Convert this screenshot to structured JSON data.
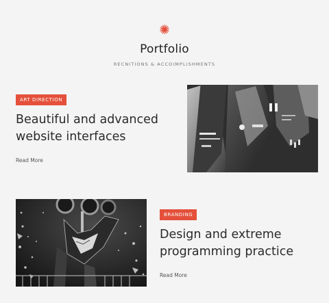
{
  "header": {
    "title": "Portfolio",
    "subtitle": "RECNITIONS & ACCOIMPLISHMENTS",
    "icon": "burst-icon",
    "accent_color": "#e4503b"
  },
  "items": [
    {
      "badge": "ART DIRECTION",
      "heading_line1": "Beautiful and advanced",
      "heading_line2": "website interfaces",
      "read_more": "Read More"
    },
    {
      "badge": "BRANDING",
      "heading_line1": "Design and extreme",
      "heading_line2": "programming practice",
      "read_more": "Read More"
    }
  ]
}
